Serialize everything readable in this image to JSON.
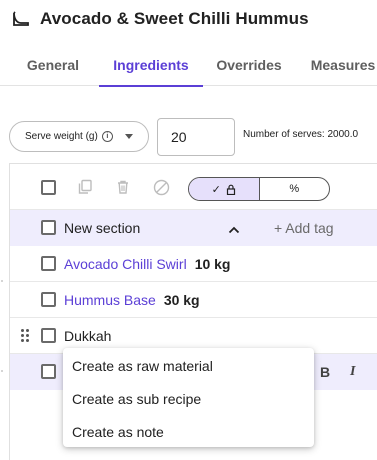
{
  "header": {
    "title": "Avocado & Sweet Chilli Hummus",
    "logo_icon": "cloche-icon"
  },
  "tabs": [
    {
      "label": "General",
      "active": false
    },
    {
      "label": "Ingredients",
      "active": true
    },
    {
      "label": "Overrides",
      "active": false
    },
    {
      "label": "Measures",
      "active": false
    }
  ],
  "serve": {
    "weight_label": "Serve weight (g)",
    "serves_value": "20",
    "serves_summary": "Number of serves: 2000.0"
  },
  "toolbar": {
    "mode_options": [
      {
        "label": "✓",
        "icon": "lock-icon",
        "selected": true
      },
      {
        "label": "%",
        "selected": false
      }
    ],
    "icons": [
      "copy-icon",
      "delete-icon",
      "block-icon"
    ]
  },
  "section": {
    "label": "New section",
    "add_tag": "+ Add tag"
  },
  "rows": [
    {
      "name": "Avocado Chilli Swirl",
      "qty": "10 kg"
    },
    {
      "name": "Hummus Base",
      "qty": "30 kg"
    },
    {
      "name": "Dukkah"
    }
  ],
  "editor_tools": [
    "B",
    "I"
  ],
  "menu": {
    "items": [
      "Create as raw material",
      "Create as sub recipe",
      "Create as note"
    ]
  },
  "colors": {
    "accent": "#5b3fd6",
    "section_bg": "#efedfd"
  }
}
